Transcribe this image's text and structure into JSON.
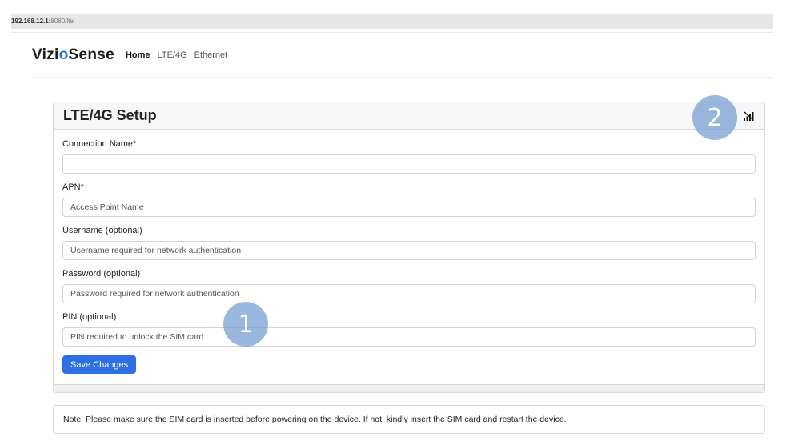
{
  "browser": {
    "url_host": "192.168.12.1:",
    "url_rest": "8080/lte"
  },
  "navbar": {
    "brand_prefix": "Vizi",
    "brand_dot": "o",
    "brand_suffix": "Sense",
    "links": [
      {
        "label": "Home",
        "active": true
      },
      {
        "label": "LTE/4G",
        "active": false
      },
      {
        "label": "Ethernet",
        "active": false
      }
    ]
  },
  "card": {
    "title": "LTE/4G Setup",
    "status_icon": "signal-off-icon",
    "fields": [
      {
        "label": "Connection Name*",
        "value": "",
        "placeholder": ""
      },
      {
        "label": "APN*",
        "value": "",
        "placeholder": "Access Point Name"
      },
      {
        "label": "Username (optional)",
        "value": "",
        "placeholder": "Username required for network authentication"
      },
      {
        "label": "Password (optional)",
        "value": "",
        "placeholder": "Password required for network authentication"
      },
      {
        "label": "PIN (optional)",
        "value": "",
        "placeholder": "PIN required to unlock the SIM card"
      }
    ],
    "save_label": "Save Changes"
  },
  "note": "Note: Please make sure the SIM card is inserted before powering on the device. If not, kindly insert the SIM card and restart the device.",
  "markers": {
    "one": "1",
    "two": "2"
  },
  "colors": {
    "primary": "#2f6fe4",
    "marker": "#78a0d2"
  }
}
